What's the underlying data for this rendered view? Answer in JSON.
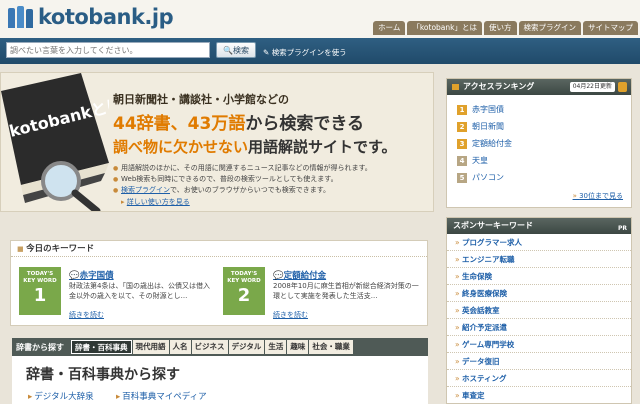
{
  "header": {
    "logo_text": "kotobank.jp",
    "nav": [
      "ホーム",
      "「kotobank」とは",
      "使い方",
      "検索プラグイン",
      "サイトマップ"
    ]
  },
  "search": {
    "placeholder": "調べたい言葉を入力してください。",
    "button_label": "検索",
    "plugin_link": "検索プラグインを使う"
  },
  "hero": {
    "book_label": "kotobankとは?",
    "line1": "朝日新聞社・講談社・小学館などの",
    "line2_hl": "44辞書、43万語",
    "line2_rest": "から検索できる",
    "line3_hl": "調べ物に欠かせない",
    "line3_rest": "用語解説サイトです。",
    "bullets": [
      "用語解説のほかに、その用語に関連するニュース記事などの情報が得られます。",
      "Web検索も同時にできるので、普段の検索ツールとしても使えます。"
    ],
    "bullet3_link": "検索プラグイン",
    "bullet3_rest": "で、お使いのブラウザからいつでも検索できます。",
    "more_link": "詳しい使い方を見る"
  },
  "keywords": {
    "heading": "今日のキーワード",
    "badge_top": "TODAY'S",
    "badge_bottom": "KEY WORD",
    "items": [
      {
        "num": "1",
        "title": "赤字国債",
        "desc": "財政法第4条は、「国の歳出は、公債又は借入金以外の歳入を以て、その財源とし...",
        "more": "続きを読む"
      },
      {
        "num": "2",
        "title": "定額給付金",
        "desc": "2008年10月に麻生首相が新総合経済対策の一環として実施を発表した生活支...",
        "more": "続きを読む"
      }
    ]
  },
  "tabs": {
    "label": "辞書から探す",
    "items": [
      "辞書・百科事典",
      "現代用語",
      "人名",
      "ビジネス",
      "デジタル",
      "生活",
      "趣味",
      "社会・職業"
    ]
  },
  "dictionary": {
    "title": "辞書・百科事典から探す",
    "links": [
      "デジタル大辞泉",
      "百科事典マイペディア"
    ]
  },
  "ranking": {
    "heading": "アクセスランキング",
    "date": "04月22日更新",
    "items": [
      {
        "num": "1",
        "label": "赤字国債"
      },
      {
        "num": "2",
        "label": "朝日新聞"
      },
      {
        "num": "3",
        "label": "定額給付金"
      },
      {
        "num": "4",
        "label": "天皇"
      },
      {
        "num": "5",
        "label": "パソコン"
      }
    ],
    "more": "30位まで見る"
  },
  "sponsor": {
    "heading": "スポンサーキーワード",
    "pr": "PR",
    "items": [
      "プログラマー求人",
      "エンジニア転職",
      "生命保険",
      "終身医療保険",
      "英会話教室",
      "紹介予定派遣",
      "ゲーム専門学校",
      "データ復旧",
      "ホスティング",
      "車査定"
    ]
  },
  "colors": {
    "brand_blue": "#2a5d85",
    "accent_orange": "#e07b00",
    "badge_green": "#7aa84a",
    "link_blue": "#1e5fa8"
  }
}
